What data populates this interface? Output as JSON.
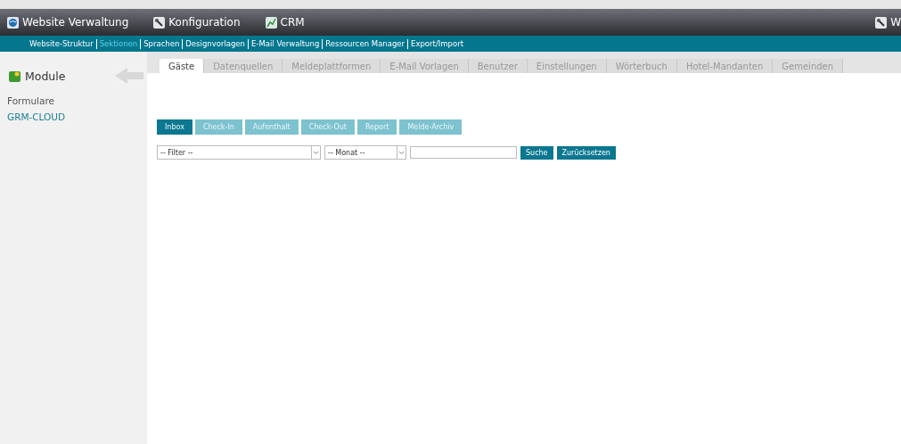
{
  "top_nav": {
    "items": [
      {
        "label": "Website Verwaltung",
        "kind": "globe"
      },
      {
        "label": "Konfiguration",
        "kind": "tool"
      },
      {
        "label": "CRM",
        "kind": "chart"
      }
    ],
    "right_item": {
      "label": "W",
      "kind": "tool"
    }
  },
  "sub_nav": [
    {
      "label": "Website-Struktur",
      "selected": false
    },
    {
      "label": "Sektionen",
      "selected": true
    },
    {
      "label": "Sprachen",
      "selected": false
    },
    {
      "label": "Designvorlagen",
      "selected": false
    },
    {
      "label": "E-Mail Verwaltung",
      "selected": false
    },
    {
      "label": "Ressourcen Manager",
      "selected": false
    },
    {
      "label": "Export/Import",
      "selected": false
    }
  ],
  "sidebar": {
    "title": "Module",
    "items": [
      {
        "label": "Formulare",
        "selected": false
      },
      {
        "label": "GRM-CLOUD",
        "selected": true
      }
    ]
  },
  "tabs": [
    {
      "label": "Gäste",
      "selected": true
    },
    {
      "label": "Datenquellen",
      "selected": false
    },
    {
      "label": "Meldeplattformen",
      "selected": false
    },
    {
      "label": "E-Mail Vorlagen",
      "selected": false
    },
    {
      "label": "Benutzer",
      "selected": false
    },
    {
      "label": "Einstellungen",
      "selected": false
    },
    {
      "label": "Wörterbuch",
      "selected": false
    },
    {
      "label": "Hotel-Mandanten",
      "selected": false
    },
    {
      "label": "Gemeinden",
      "selected": false
    }
  ],
  "actions": [
    {
      "label": "Inbox",
      "selected": true
    },
    {
      "label": "Check-In",
      "selected": false
    },
    {
      "label": "Aufenthalt",
      "selected": false
    },
    {
      "label": "Check-Out",
      "selected": false
    },
    {
      "label": "Report",
      "selected": false
    },
    {
      "label": "Melde-Archiv",
      "selected": false
    }
  ],
  "filters": {
    "filter_select": "-- Filter --",
    "month_select": "-- Monat --",
    "search_button": "Suche",
    "reset_button": "Zurücksetzen"
  }
}
